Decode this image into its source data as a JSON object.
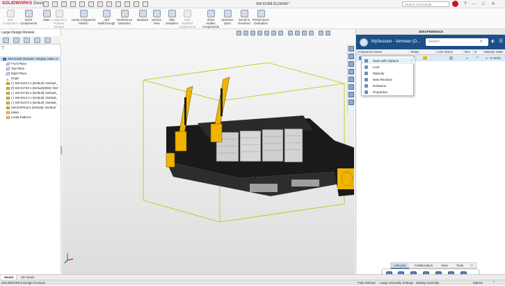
{
  "app": {
    "brand": "SOLIDWORKS",
    "brand_suffix": "Design",
    "document_title": "SW-01368.SLDASM *",
    "search_placeholder": "Search Commands"
  },
  "ribbon": {
    "buttons": [
      {
        "label": "Edit\nComponent",
        "enabled": false
      },
      {
        "label": "Insert\nComponents",
        "enabled": true
      },
      {
        "label": "Mate",
        "enabled": true
      },
      {
        "label": "Component\nPreview\nWindow",
        "enabled": false
      },
      {
        "label": "Linear Component\nPattern",
        "enabled": true
      },
      {
        "label": "Add\nWalk-through",
        "enabled": true
      },
      {
        "label": "Interference\nDetection",
        "enabled": true
      },
      {
        "label": "Measure",
        "enabled": true
      },
      {
        "label": "Section\nView",
        "enabled": true
      },
      {
        "label": "Take\nSnapshot",
        "enabled": true
      },
      {
        "label": "Print\nModified\nComponents",
        "enabled": false
      },
      {
        "label": "Show\nHidden\nComponents",
        "enabled": true
      },
      {
        "label": "Selective\nOpen",
        "enabled": true
      },
      {
        "label": "Set all to\nResolved",
        "enabled": true
      },
      {
        "label": "Performance\nEvaluation",
        "enabled": true
      }
    ]
  },
  "left_panel": {
    "title": "Large Design Review",
    "tree": [
      {
        "label": "SW-01368 (Default) <Display State 1>",
        "icon": "asm",
        "selected": true
      },
      {
        "label": "Front Plane",
        "icon": "plane"
      },
      {
        "label": "Top Plane",
        "icon": "plane"
      },
      {
        "label": "Right Plane",
        "icon": "plane"
      },
      {
        "label": "Origin",
        "icon": "orig"
      },
      {
        "label": "(-) SW-01571-1 (Default) <Default_",
        "icon": "part"
      },
      {
        "label": "(f) SW-01703-1 (Default)(Wkt) <Def",
        "icon": "part"
      },
      {
        "label": "(-) SW-01735-1 (Default) <Default_",
        "icon": "part"
      },
      {
        "label": "(-) SW-02147-1 (Default) <Default_",
        "icon": "part"
      },
      {
        "label": "(-) SW-01370-1 (Default) <Default_",
        "icon": "part"
      },
      {
        "label": "SW-Drill-Rod-1 (Default) <Default",
        "icon": "part"
      },
      {
        "label": "Mates",
        "icon": "fold"
      },
      {
        "label": "LocalLPattern1",
        "icon": "fold"
      }
    ]
  },
  "xp_panel": {
    "header": "3DEXPERIENCE",
    "session": "MySession - Vermeer (D...",
    "search_placeholder": "Search",
    "columns": [
      "Component Name",
      "Status",
      "Lock Status",
      "Rev",
      "Is",
      "Maturity State"
    ],
    "row": {
      "name": "",
      "rev": "A",
      "maturity": "A - In Work"
    },
    "context_menu": [
      "Save with Options",
      "Lock",
      "Maturity",
      "New Revision",
      "Relations",
      "Properties"
    ],
    "tabs": [
      "Lifecycle",
      "Collaboration",
      "View",
      "Tools"
    ],
    "active_tab": "Lifecycle"
  },
  "bottom_tabs": [
    "Model",
    "3D Views"
  ],
  "status_bar": {
    "left": "SOLIDWORKS Design Premium",
    "defined": "Fully Defined",
    "mode": "Large Assembly Settings",
    "editing": "Editing Assembly",
    "units": "MMGS"
  },
  "colors": {
    "accent": "#1b4f8a",
    "machine": "#f0b400",
    "bbox": "#b8c400"
  }
}
